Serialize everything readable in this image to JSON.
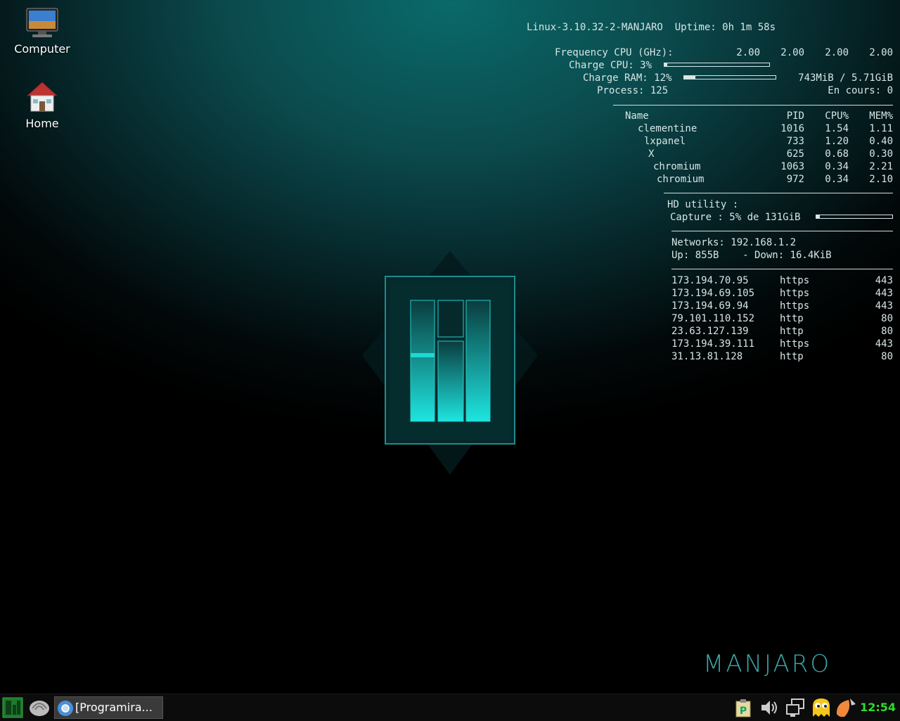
{
  "desktop": {
    "icons": [
      {
        "label": "Computer",
        "icon": "computer-monitor-icon"
      },
      {
        "label": "Home",
        "icon": "home-house-icon"
      }
    ],
    "brand": "MANJARO"
  },
  "conky": {
    "kernel_line": "Linux-3.10.32-2-MANJARO  Uptime: 0h 1m 58s",
    "freq_label": "Frequency CPU (GHz):",
    "freqs": [
      "2.00",
      "2.00",
      "2.00",
      "2.00"
    ],
    "cpu_label": "Charge CPU: 3%",
    "cpu_percent": 3,
    "ram_label": "Charge RAM: 12%",
    "ram_percent": 12,
    "ram_usage": "743MiB / 5.71GiB",
    "process_label": "Process: 125",
    "running_label": "En cours: 0",
    "proc_headers": {
      "name": "Name",
      "pid": "PID",
      "cpu": "CPU%",
      "mem": "MEM%"
    },
    "processes": [
      {
        "name": "clementine",
        "pid": "1016",
        "cpu": "1.54",
        "mem": "1.11"
      },
      {
        "name": "lxpanel",
        "pid": "733",
        "cpu": "1.20",
        "mem": "0.40"
      },
      {
        "name": "X",
        "pid": "625",
        "cpu": "0.68",
        "mem": "0.30"
      },
      {
        "name": "chromium",
        "pid": "1063",
        "cpu": "0.34",
        "mem": "2.21"
      },
      {
        "name": "chromium",
        "pid": "972",
        "cpu": "0.34",
        "mem": "2.10"
      }
    ],
    "hd_title": "HD utility :",
    "hd_label": "Capture : 5% de 131GiB",
    "hd_percent": 5,
    "net_label": "Networks: 192.168.1.2",
    "net_traffic": "Up: 855B    - Down: 16.4KiB",
    "connections": [
      {
        "ip": "173.194.70.95",
        "proto": "https",
        "port": "443"
      },
      {
        "ip": "173.194.69.105",
        "proto": "https",
        "port": "443"
      },
      {
        "ip": "173.194.69.94",
        "proto": "https",
        "port": "443"
      },
      {
        "ip": "79.101.110.152",
        "proto": "http",
        "port": "80"
      },
      {
        "ip": "23.63.127.139",
        "proto": "http",
        "port": "80"
      },
      {
        "ip": "173.194.39.111",
        "proto": "https",
        "port": "443"
      },
      {
        "ip": "31.13.81.128",
        "proto": "http",
        "port": "80"
      }
    ]
  },
  "taskbar": {
    "menu_icon": "manjaro-menu-icon",
    "file_manager_icon": "shell-file-manager-icon",
    "task_label": "[Programira...",
    "task_icon": "chromium-icon",
    "tray_icons": [
      "clipboard-p-icon",
      "volume-icon",
      "network-screens-icon",
      "pacman-ghost-icon",
      "clementine-icon"
    ],
    "clock": "12:54",
    "clock_color": "#2fdc2f"
  }
}
